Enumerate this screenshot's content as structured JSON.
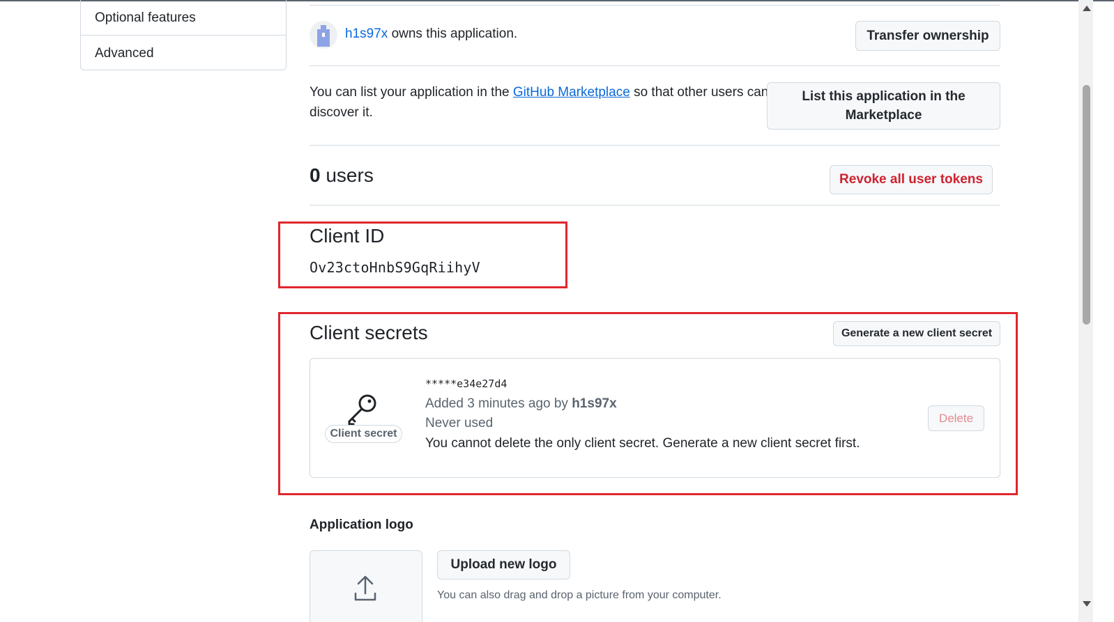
{
  "sidebar": {
    "items": [
      {
        "label": "Optional features"
      },
      {
        "label": "Advanced"
      }
    ]
  },
  "owner": {
    "username": "h1s97x",
    "suffix": "owns this application.",
    "transfer_button": "Transfer ownership"
  },
  "marketplace": {
    "text_before": "You can list your application in the",
    "link": "GitHub Marketplace",
    "text_after": "so that other users can discover it.",
    "button": "List this application in the Marketplace"
  },
  "users": {
    "count": "0",
    "label": "users",
    "revoke_button": "Revoke all user tokens"
  },
  "client_id": {
    "heading": "Client ID",
    "value": "Ov23ctoHnbS9GqRiihyV"
  },
  "client_secrets": {
    "heading": "Client secrets",
    "generate_button": "Generate a new client secret",
    "secret": {
      "badge": "Client secret",
      "masked": "*****e34e27d4",
      "added_prefix": "Added 3 minutes ago by",
      "added_by": "h1s97x",
      "usage": "Never used",
      "warning": "You cannot delete the only client secret. Generate a new client secret first.",
      "delete_button": "Delete"
    }
  },
  "logo": {
    "heading": "Application logo",
    "upload_button": "Upload new logo",
    "hint": "You can also drag and drop a picture from your computer."
  },
  "colors": {
    "link": "#0969da",
    "danger": "#cf222e",
    "highlight_box": "#e0262d",
    "border": "#d1d9e0"
  },
  "icons": [
    "avatar-icon",
    "key-icon",
    "upload-icon",
    "scroll-up-arrow-icon",
    "scroll-down-arrow-icon"
  ]
}
